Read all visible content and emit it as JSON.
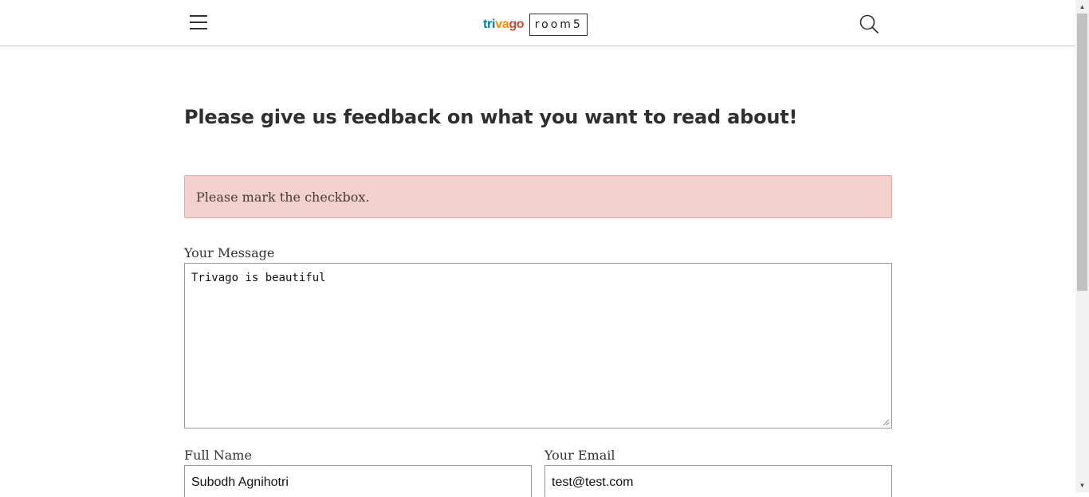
{
  "header": {
    "menu_icon": "hamburger-menu-icon",
    "logo": {
      "trivago_letters": [
        {
          "text": "tri",
          "color": "#007FAD"
        },
        {
          "text": "va",
          "color": "#F48F00"
        },
        {
          "text": "go",
          "color": "#C94A38"
        }
      ],
      "room5": "room5"
    },
    "search_icon": "search-icon"
  },
  "main": {
    "title": "Please give us feedback on what you want to read about!",
    "alert": {
      "text": "Please mark the checkbox.",
      "bg_color": "#F2D0CB"
    },
    "message": {
      "label": "Your Message",
      "value": "Trivago is beautiful"
    },
    "full_name": {
      "label": "Full Name",
      "value": "Subodh Agnihotri"
    },
    "email": {
      "label": "Your Email",
      "value": "test@test.com"
    }
  },
  "scrollbar": {
    "up_icon": "▲",
    "down_icon": "▼"
  }
}
